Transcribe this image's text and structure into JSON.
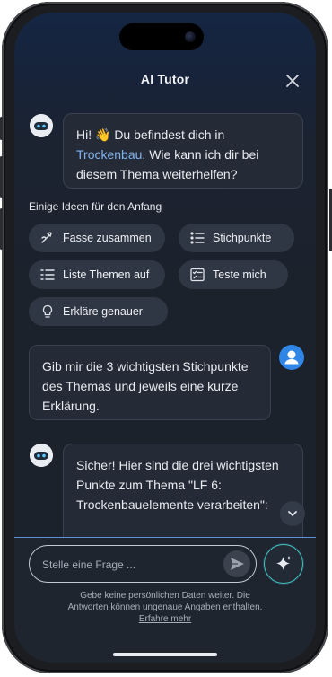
{
  "header": {
    "title": "AI Tutor",
    "close_icon": "close-icon"
  },
  "messages": [
    {
      "sender": "bot",
      "avatar_icon": "robot-icon",
      "parts": {
        "greeting": "Hi! 👋 Du befindest dich in",
        "topic": "Trockenbau",
        "rest": ". Wie kann ich dir bei diesem Thema weiterhelfen?"
      }
    },
    {
      "sender": "user",
      "avatar_icon": "user-icon",
      "text": "Gib mir die 3 wichtigsten Stichpunkte des Themas und jeweils eine kurze Erklärung."
    },
    {
      "sender": "bot",
      "avatar_icon": "robot-icon",
      "text": "Sicher! Hier sind die drei wichtigsten Punkte zum Thema \"LF 6: Trockenbauelemente verarbeiten\":"
    }
  ],
  "ideas": {
    "heading": "Einige Ideen für den Anfang",
    "chips": [
      {
        "label": "Fasse zusammen",
        "icon": "summarize-icon"
      },
      {
        "label": "Stichpunkte",
        "icon": "bullet-list-icon"
      },
      {
        "label": "Liste Themen auf",
        "icon": "list-icon"
      },
      {
        "label": "Teste mich",
        "icon": "quiz-icon"
      },
      {
        "label": "Erkläre genauer",
        "icon": "lightbulb-icon"
      }
    ]
  },
  "composer": {
    "placeholder": "Stelle eine Frage ...",
    "send_icon": "send-icon",
    "magic_icon": "sparkle-icon",
    "scroll_icon": "chevron-down-icon"
  },
  "disclaimer": {
    "text": "Gebe keine persönlichen Daten weiter. Die Antworten können ungenaue Angaben enthalten.",
    "link": "Erfahre mehr"
  },
  "colors": {
    "accent": "#2f86e6",
    "link": "#7fb2ef",
    "background": "#1c222c"
  }
}
